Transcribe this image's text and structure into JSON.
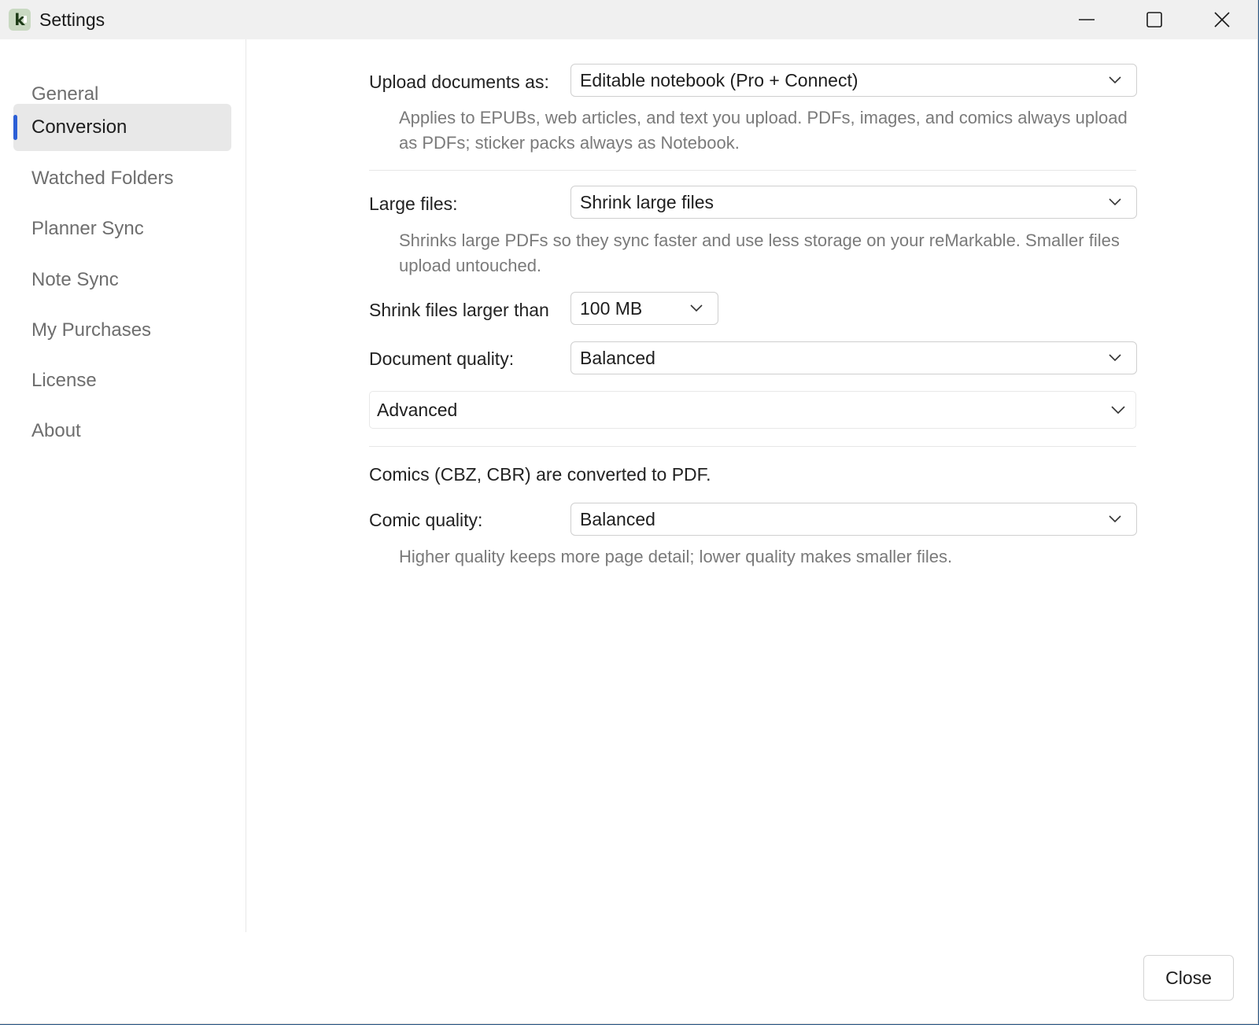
{
  "window": {
    "title": "Settings",
    "icon_letter": "k"
  },
  "sidebar": {
    "items": [
      {
        "label": "General"
      },
      {
        "label": "Conversion"
      },
      {
        "label": "Watched Folders"
      },
      {
        "label": "Planner Sync"
      },
      {
        "label": "Note Sync"
      },
      {
        "label": "My Purchases"
      },
      {
        "label": "License"
      },
      {
        "label": "About"
      }
    ],
    "active": "Conversion"
  },
  "conversion": {
    "upload_as": {
      "label": "Upload documents as:",
      "value": "Editable notebook (Pro + Connect)",
      "help": "Applies to EPUBs, web articles, and text you upload. PDFs, images, and comics always upload as PDFs; sticker packs always as Notebook."
    },
    "large_files": {
      "label": "Large files:",
      "value": "Shrink large files",
      "help": "Shrinks large PDFs so they sync faster and use less storage on your reMarkable. Smaller files upload untouched."
    },
    "shrink_threshold": {
      "label": "Shrink files larger than",
      "value": "100 MB"
    },
    "document_quality": {
      "label": "Document quality:",
      "value": "Balanced"
    },
    "advanced": {
      "label": "Advanced"
    },
    "comics_note": "Comics (CBZ, CBR) are converted to PDF.",
    "comic_quality": {
      "label": "Comic quality:",
      "value": "Balanced",
      "help": "Higher quality keeps more page detail; lower quality makes smaller files."
    }
  },
  "footer": {
    "close_label": "Close"
  },
  "colors": {
    "accent": "#2c5fd6",
    "sidebar_active_bg": "#e8e8e8",
    "help_text": "#7a7a7a"
  }
}
